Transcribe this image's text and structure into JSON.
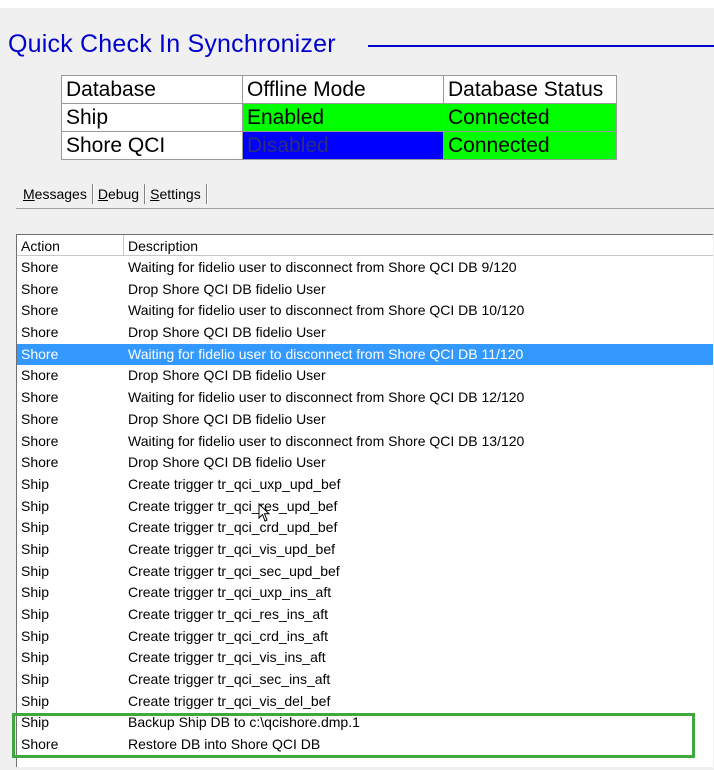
{
  "app": {
    "title": "Quick Check In Synchronizer"
  },
  "status_table": {
    "headers": [
      "Database",
      "Offline Mode",
      "Database Status"
    ],
    "rows": [
      {
        "database": "Ship",
        "offline_mode": "Enabled",
        "offline_color": "#00ff00",
        "status": "Connected",
        "status_color": "#00ff00"
      },
      {
        "database": "Shore QCI",
        "offline_mode": "Disabled",
        "offline_color": "#0000ff",
        "status": "Connected",
        "status_color": "#00ff00"
      }
    ]
  },
  "tabs": [
    {
      "label_u": "M",
      "label_rest": "essages"
    },
    {
      "label_u": "D",
      "label_rest": "ebug"
    },
    {
      "label_u": "S",
      "label_rest": "ettings"
    }
  ],
  "messages": {
    "columns": {
      "action": "Action",
      "description": "Description"
    },
    "rows": [
      {
        "action": "Shore",
        "description": "Waiting for fidelio user to disconnect from Shore QCI DB 9/120"
      },
      {
        "action": "Shore",
        "description": "Drop Shore QCI DB fidelio User"
      },
      {
        "action": "Shore",
        "description": "Waiting for fidelio user to disconnect from Shore QCI DB 10/120"
      },
      {
        "action": "Shore",
        "description": "Drop Shore QCI DB fidelio User"
      },
      {
        "action": "Shore",
        "description": "Waiting for fidelio user to disconnect from Shore QCI DB 11/120",
        "selected": true
      },
      {
        "action": "Shore",
        "description": "Drop Shore QCI DB fidelio User"
      },
      {
        "action": "Shore",
        "description": "Waiting for fidelio user to disconnect from Shore QCI DB 12/120"
      },
      {
        "action": "Shore",
        "description": "Drop Shore QCI DB fidelio User"
      },
      {
        "action": "Shore",
        "description": "Waiting for fidelio user to disconnect from Shore QCI DB 13/120"
      },
      {
        "action": "Shore",
        "description": "Drop Shore QCI DB fidelio User"
      },
      {
        "action": "Ship",
        "description": "Create trigger tr_qci_uxp_upd_bef"
      },
      {
        "action": "Ship",
        "description": "Create trigger tr_qci_res_upd_bef"
      },
      {
        "action": "Ship",
        "description": "Create trigger tr_qci_crd_upd_bef"
      },
      {
        "action": "Ship",
        "description": "Create trigger tr_qci_vis_upd_bef"
      },
      {
        "action": "Ship",
        "description": "Create trigger tr_qci_sec_upd_bef"
      },
      {
        "action": "Ship",
        "description": "Create trigger tr_qci_uxp_ins_aft"
      },
      {
        "action": "Ship",
        "description": "Create trigger tr_qci_res_ins_aft"
      },
      {
        "action": "Ship",
        "description": "Create trigger tr_qci_crd_ins_aft"
      },
      {
        "action": "Ship",
        "description": "Create trigger tr_qci_vis_ins_aft"
      },
      {
        "action": "Ship",
        "description": "Create trigger tr_qci_sec_ins_aft"
      },
      {
        "action": "Ship",
        "description": "Create trigger tr_qci_vis_del_bef"
      },
      {
        "action": "Ship",
        "description": "Backup Ship DB to c:\\qcishore.dmp.1"
      },
      {
        "action": "Shore",
        "description": "Restore DB into Shore QCI DB"
      }
    ]
  },
  "colors": {
    "title": "#0000cc",
    "selection": "#3399ff",
    "highlight_box": "#3fa83f"
  }
}
